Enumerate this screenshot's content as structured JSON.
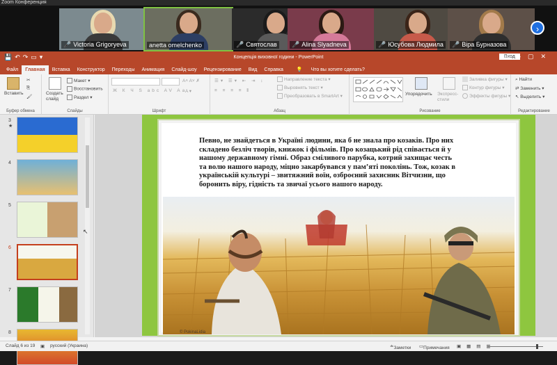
{
  "zoom": {
    "window_title": "Zoom Конференция",
    "participants": [
      {
        "name": "Victoria Grigoryeva",
        "muted": true,
        "active": false,
        "bg": "#7c8a8f",
        "hair": "#e8d9b0",
        "shirt": "#3a3a3a"
      },
      {
        "name": "anetta omelchenko",
        "muted": false,
        "active": true,
        "bg": "#6c6e60",
        "hair": "#3a2a1e",
        "shirt": "#2d3e63"
      },
      {
        "name": "Святослав",
        "muted": true,
        "active": false,
        "bg": "#2b2b2b",
        "hair": "#1b1b1b",
        "shirt": "#5a5a5a"
      },
      {
        "name": "Alina Slyadneva",
        "muted": true,
        "active": false,
        "bg": "#7a3b4b",
        "hair": "#2b1a14",
        "shirt": "#d57a9a"
      },
      {
        "name": "Юсубова Людмила",
        "muted": true,
        "active": false,
        "bg": "#4f4a42",
        "hair": "#3b2418",
        "shirt": "#c75a4a"
      },
      {
        "name": "Віра Бурназова",
        "muted": true,
        "active": false,
        "bg": "#5d5048",
        "hair": "#a27a4a",
        "shirt": "#2e2e2e"
      }
    ],
    "next_icon": "chevron-right-icon"
  },
  "ppt": {
    "doc_title": "Концепція виховної години  -  PowerPoint",
    "login_label": "Вход",
    "tabs": [
      "Файл",
      "Главная",
      "Вставка",
      "Конструктор",
      "Переходы",
      "Анимация",
      "Слайд-шоу",
      "Рецензирование",
      "Вид",
      "Справка"
    ],
    "selected_tab": "Главная",
    "tell_me": "Что вы хотите сделать?",
    "ribbon": {
      "paste": "Вставить",
      "new_slide": "Создать слайд",
      "layout": "Макет",
      "reset": "Восстановить",
      "section": "Раздел",
      "text_direction": "Направление текста",
      "align_text": "Выровнять текст",
      "smartart": "Преобразовать в SmartArt",
      "arrange": "Упорядочить",
      "quick_styles": "Экспресс-стили",
      "shape_fill": "Заливка фигуры",
      "shape_outline": "Контур фигуры",
      "shape_effects": "Эффекты фигуры",
      "find": "Найти",
      "replace": "Заменить",
      "select": "Выделить",
      "groups": [
        "Буфер обмена",
        "Слайды",
        "Шрифт",
        "Абзац",
        "Рисование",
        "Редактирование"
      ]
    },
    "thumbnails": [
      {
        "num": "3",
        "star": "★"
      },
      {
        "num": "4",
        "star": ""
      },
      {
        "num": "5",
        "star": ""
      },
      {
        "num": "6",
        "star": ""
      },
      {
        "num": "7",
        "star": ""
      },
      {
        "num": "8",
        "star": ""
      }
    ],
    "selected_slide": "6",
    "slide": {
      "text": "Певно, не знайдеться в Україні людини, яка б не знала про козаків. Про них складено безліч творів, книжок і фільмів. Про козацький рід співається й у нашому державному гімні. Образ сміливого парубка, котрий захищає честь та волю нашого народу, міцно закарбувався  у пам’яті поколінь. Тож, козак в українській культурі – звитяжний воїн, озброєний захисник Вітчизни, що боронить віру, гідність та звичаї усього нашого народу.",
      "credit": "© PokinaLidia"
    },
    "status": {
      "slide_counter": "Слайд 6 из 19",
      "language": "русский (Украина)",
      "notes": "Заметки",
      "comments": "Примечания"
    }
  },
  "colors": {
    "accent": "#b7472a",
    "slide_green": "#8ec63f"
  }
}
